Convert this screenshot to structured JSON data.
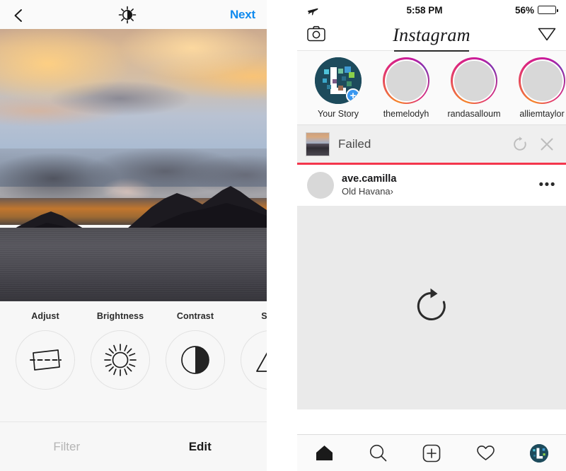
{
  "editor": {
    "header": {
      "back_icon": "back-chevron-icon",
      "center_icon": "brightness-sun-icon",
      "next_label": "Next"
    },
    "photo": {
      "alt": "sunset-landscape-photo"
    },
    "tools": [
      {
        "label": "Adjust",
        "icon": "adjust-icon"
      },
      {
        "label": "Brightness",
        "icon": "sun-icon"
      },
      {
        "label": "Contrast",
        "icon": "contrast-icon"
      },
      {
        "label": "Stru",
        "icon": "structure-icon"
      }
    ],
    "tabs": [
      {
        "label": "Filter",
        "active": false
      },
      {
        "label": "Edit",
        "active": true
      }
    ]
  },
  "phone": {
    "status_bar": {
      "airplane_icon": "airplane-mode-icon",
      "time": "5:58 PM",
      "battery_percent": "56%",
      "battery_level": 56
    },
    "header": {
      "camera_icon": "camera-icon",
      "title": "Instagram",
      "direct_icon": "paper-plane-icon"
    },
    "stories": [
      {
        "name": "Your Story",
        "type": "own",
        "badge": "+"
      },
      {
        "name": "themelodyh",
        "type": "ring"
      },
      {
        "name": "randasalloum",
        "type": "ring"
      },
      {
        "name": "alliemtaylor",
        "type": "ring"
      }
    ],
    "failed_banner": {
      "text": "Failed",
      "retry_icon": "retry-icon",
      "close_icon": "close-icon",
      "thumbnail": "upload-thumbnail"
    },
    "post": {
      "username": "ave.camilla",
      "location": "Old Havana",
      "location_chevron": "›",
      "options_label": "•••",
      "body_icon": "retry-icon"
    },
    "tabbar": [
      {
        "icon": "home-icon",
        "active": true
      },
      {
        "icon": "search-icon",
        "active": false
      },
      {
        "icon": "add-post-icon",
        "active": false
      },
      {
        "icon": "heart-icon",
        "active": false
      },
      {
        "icon": "profile-avatar-icon",
        "active": false
      }
    ]
  },
  "colors": {
    "accent_blue": "#0f8aee",
    "error_red": "#f4364c",
    "story_gradient_start": "#f58529",
    "story_gradient_mid": "#dd2a7b",
    "story_gradient_end": "#8134af",
    "avatar_teal": "#1d4b5c"
  }
}
